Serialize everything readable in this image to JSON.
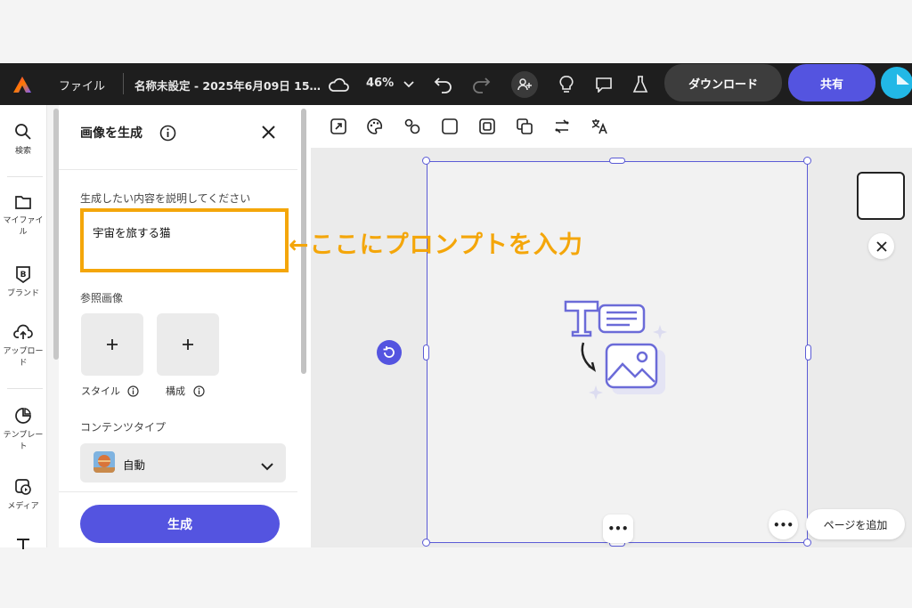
{
  "topbar": {
    "file_menu": "ファイル",
    "doc_title": "名称未設定 - 2025年6月09日 15…",
    "zoom": "46%",
    "download_label": "ダウンロード",
    "share_label": "共有"
  },
  "rail": {
    "items": [
      {
        "label": "検索",
        "icon": "search-icon"
      },
      {
        "label": "マイファイル",
        "icon": "folder-icon"
      },
      {
        "label": "ブランド",
        "icon": "brand-icon"
      },
      {
        "label": "アップロード",
        "icon": "upload-icon"
      },
      {
        "label": "テンプレート",
        "icon": "template-icon"
      },
      {
        "label": "メディア",
        "icon": "media-icon"
      },
      {
        "label": "",
        "icon": "text-icon"
      }
    ]
  },
  "panel": {
    "title": "画像を生成",
    "prompt_label": "生成したい内容を説明してください",
    "prompt_value": "宇宙を旅する猫",
    "reference_label": "参照画像",
    "style_label": "スタイル",
    "composition_label": "構成",
    "content_type_label": "コンテンツタイプ",
    "content_type_value": "自動",
    "generate_label": "生成"
  },
  "annotation": {
    "text": "←ここにプロンプトを入力",
    "color": "#f4a60a"
  },
  "canvas": {
    "add_page_label": "ページを追加",
    "more_label": "•••"
  },
  "colors": {
    "accent": "#5454e0",
    "selection": "#5b5bd6",
    "highlight": "#f4a60a"
  }
}
